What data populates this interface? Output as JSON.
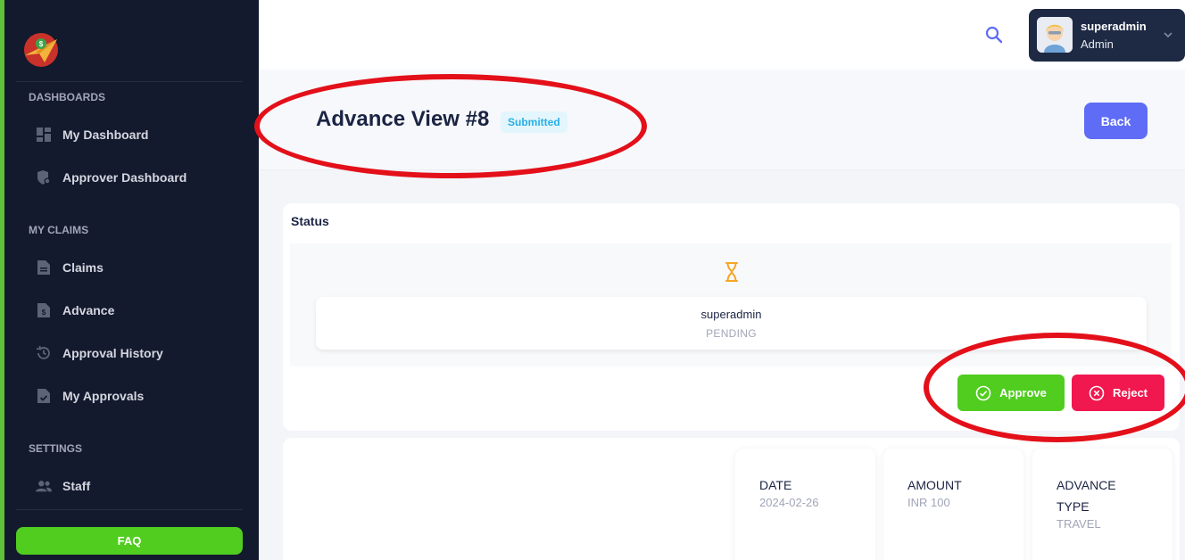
{
  "sidebar": {
    "sections": [
      {
        "title": "DASHBOARDS",
        "items": [
          {
            "label": "My Dashboard",
            "icon": "dashboard-icon"
          },
          {
            "label": "Approver Dashboard",
            "icon": "shield-settings-icon"
          }
        ]
      },
      {
        "title": "MY CLAIMS",
        "items": [
          {
            "label": "Claims",
            "icon": "document-icon"
          },
          {
            "label": "Advance",
            "icon": "money-file-icon"
          },
          {
            "label": "Approval History",
            "icon": "history-icon"
          },
          {
            "label": "My Approvals",
            "icon": "file-check-icon"
          }
        ]
      },
      {
        "title": "SETTINGS",
        "items": [
          {
            "label": "Staff",
            "icon": "users-icon"
          }
        ]
      }
    ],
    "faq_label": "FAQ"
  },
  "header": {
    "user": {
      "name": "superadmin",
      "role": "Admin"
    }
  },
  "toolbar": {
    "title": "Advance View #8",
    "badge": "Submitted",
    "back_label": "Back"
  },
  "status": {
    "title": "Status",
    "approver": "superadmin",
    "approver_status": "PENDING",
    "approve_label": "Approve",
    "reject_label": "Reject"
  },
  "details": {
    "date_label": "DATE",
    "date_value": "2024-02-26",
    "amount_label": "AMOUNT",
    "amount_value": "INR 100",
    "type_label": "ADVANCE TYPE",
    "type_value": "TRAVEL"
  },
  "colors": {
    "sidebar_bg": "#141a2d",
    "approve": "#50cd1f",
    "reject": "#f1174f",
    "primary": "#5e6cf6",
    "annotation": "#e3101a"
  }
}
